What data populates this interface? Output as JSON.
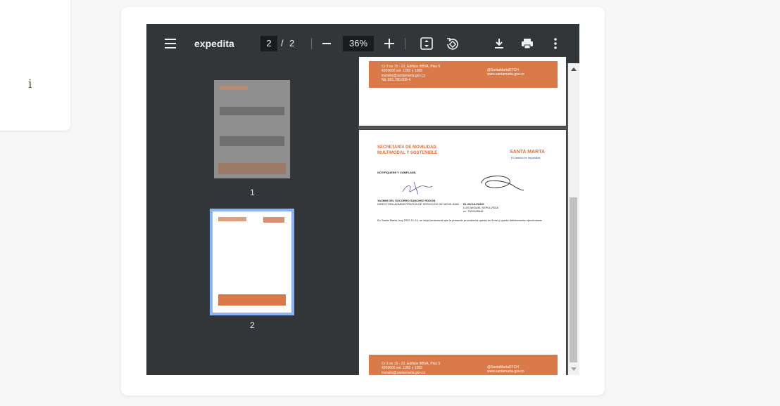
{
  "side": {
    "info_glyph": "i"
  },
  "toolbar": {
    "title": "expedita",
    "current_page": "2",
    "separator": "/",
    "total_pages": "2",
    "zoom": "36%"
  },
  "thumbnails": [
    {
      "label": "1"
    },
    {
      "label": "2"
    }
  ],
  "document": {
    "header_line1": "SECRETARÍA DE MOVILIDAD",
    "header_line2": "MULTIMODAL Y SOSTENIBLE",
    "logo": "SANTA MARTA",
    "logo_tag": "El cambio es imparable",
    "notify": "NOTIFÍQUESE Y CÚMPLASE,",
    "signer1_name": "YAZMIN DEL SOCORRO SANCHEZ RODON",
    "signer1_title": "DIRECTORA ADMINISTRATIVA DE SERVICIOS DE MOVILIDAD",
    "signer2_role": "EL INCULPADO",
    "signer2_name": "LUIS MIGUEL SEPULVEDA",
    "signer2_id": "cc. 7001345645",
    "closing": "En Santa Marta, hoy 2022-11-14, se deja constancia que la presente providencia queda en firme y queda debidamente ejecutoriada",
    "footer_address": "Cr 3 no 15 - 22, Edificio BBVA, Piso 6",
    "footer_phone": "4209600 ext. 1282 y 1283",
    "footer_email": "transito@santamarta.gov.co",
    "footer_nit": "Nit: 891.780.009-4",
    "footer_social": "@SantaMartaDTCH",
    "footer_web": "www.santamarta.gov.co"
  },
  "colors": {
    "accent": "#d97a48",
    "toolbar": "#323639",
    "viewer_bg": "#525659",
    "thumb_selected": "#8ab4f8"
  }
}
